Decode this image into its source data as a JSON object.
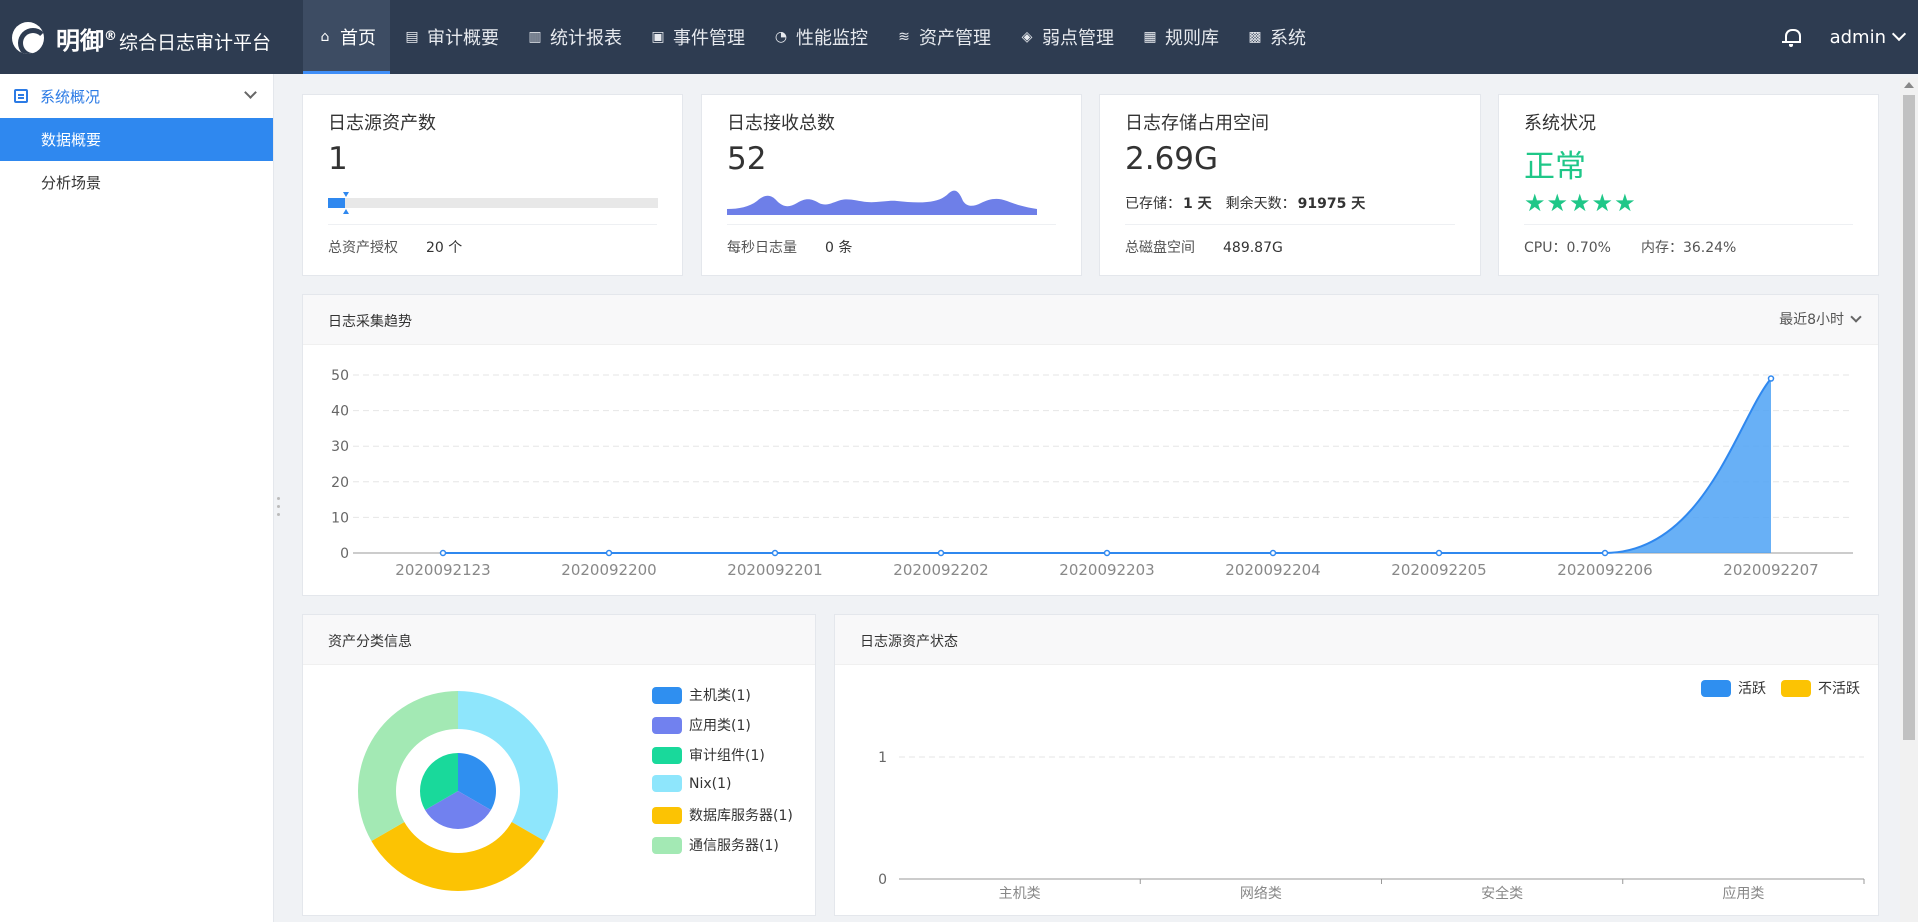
{
  "header": {
    "brand_main": "明御",
    "brand_reg": "®",
    "brand_sub": "综合日志审计平台",
    "nav": [
      {
        "label": "首页",
        "icon": "home-icon"
      },
      {
        "label": "审计概要",
        "icon": "report-icon"
      },
      {
        "label": "统计报表",
        "icon": "bar-chart-icon"
      },
      {
        "label": "事件管理",
        "icon": "clipboard-icon"
      },
      {
        "label": "性能监控",
        "icon": "gauge-icon"
      },
      {
        "label": "资产管理",
        "icon": "database-icon"
      },
      {
        "label": "弱点管理",
        "icon": "target-icon"
      },
      {
        "label": "规则库",
        "icon": "document-icon"
      },
      {
        "label": "系统",
        "icon": "grid-icon"
      }
    ],
    "user": "admin"
  },
  "sidebar": {
    "group": "系统概况",
    "items": [
      "数据概要",
      "分析场景"
    ]
  },
  "stats": {
    "assets": {
      "title": "日志源资产数",
      "value": "1",
      "progress": 0.05,
      "foot_label": "总资产授权",
      "foot_value": "20 个"
    },
    "received": {
      "title": "日志接收总数",
      "value": "52",
      "foot_label": "每秒日志量",
      "foot_value": "0 条"
    },
    "storage": {
      "title": "日志存储占用空间",
      "value": "2.69G",
      "stored_label": "已存储：",
      "stored_value": "1 天",
      "remain_label": "剩余天数：",
      "remain_value": "91975 天",
      "foot_label": "总磁盘空间",
      "foot_value": "489.87G"
    },
    "system": {
      "title": "系统状况",
      "value": "正常",
      "stars": 5,
      "cpu": "CPU：0.70%",
      "mem": "内存：36.24%"
    }
  },
  "trend": {
    "title": "日志采集趋势",
    "range": "最近8小时"
  },
  "asset_class": {
    "title": "资产分类信息"
  },
  "asset_status": {
    "title": "日志源资产状态"
  },
  "chart_data": [
    {
      "type": "area",
      "title": "日志采集趋势",
      "categories": [
        "2020092123",
        "2020092200",
        "2020092201",
        "2020092202",
        "2020092203",
        "2020092204",
        "2020092205",
        "2020092206",
        "2020092207"
      ],
      "values": [
        0,
        0,
        0,
        0,
        0,
        0,
        0,
        0,
        49
      ],
      "ylim": [
        0,
        50
      ],
      "yticks": [
        0,
        10,
        20,
        30,
        40,
        50
      ],
      "grid": true,
      "color": "#4da2f4"
    },
    {
      "type": "pie",
      "title": "资产分类信息",
      "legend": [
        "主机类(1)",
        "应用类(1)",
        "审计组件(1)",
        "Nix(1)",
        "数据库服务器(1)",
        "通信服务器(1)"
      ],
      "colors": [
        "#2f8ff0",
        "#7181ef",
        "#19d99b",
        "#8ee6fc",
        "#fcc303",
        "#a3e9b4"
      ],
      "inner": [
        {
          "label": "主机类",
          "value": 1,
          "color": "#2f8ff0"
        },
        {
          "label": "应用类",
          "value": 1,
          "color": "#7181ef"
        },
        {
          "label": "审计组件",
          "value": 1,
          "color": "#19d99b"
        }
      ],
      "outer": [
        {
          "label": "Nix",
          "value": 1,
          "color": "#8ee6fc"
        },
        {
          "label": "数据库服务器",
          "value": 1,
          "color": "#fcc303"
        },
        {
          "label": "通信服务器",
          "value": 1,
          "color": "#a3e9b4"
        }
      ],
      "legend_position": "right"
    },
    {
      "type": "bar",
      "title": "日志源资产状态",
      "categories": [
        "主机类",
        "网络类",
        "安全类",
        "应用类"
      ],
      "series": [
        {
          "name": "活跃",
          "values": [
            0,
            0,
            0,
            0
          ],
          "color": "#2f8ff0"
        },
        {
          "name": "不活跃",
          "values": [
            0,
            0,
            0,
            0
          ],
          "color": "#fcc303"
        }
      ],
      "ylim": [
        0,
        1
      ],
      "yticks": [
        0,
        1
      ],
      "grid": true,
      "legend_position": "top-right"
    }
  ]
}
